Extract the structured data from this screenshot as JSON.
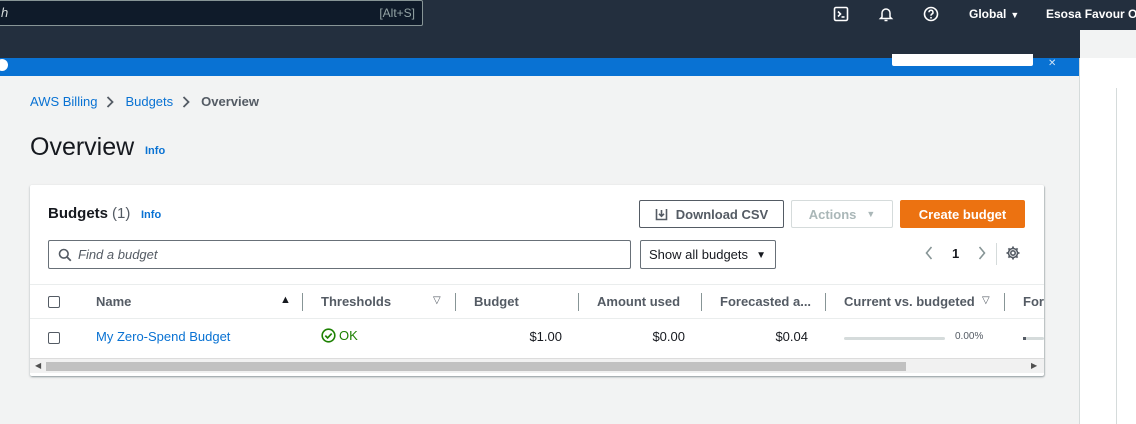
{
  "topnav": {
    "search_stub": "h",
    "search_shortcut": "[Alt+S]",
    "region_label": "Global",
    "account_label": "Esosa Favour O"
  },
  "breadcrumb": {
    "items": [
      "AWS Billing",
      "Budgets"
    ],
    "current": "Overview"
  },
  "page": {
    "title": "Overview",
    "info": "Info"
  },
  "budgets": {
    "title": "Budgets",
    "count": "(1)",
    "info": "Info",
    "download_label": "Download CSV",
    "actions_label": "Actions",
    "create_label": "Create budget",
    "search_placeholder": "Find a budget",
    "filter_value": "Show all budgets",
    "page_number": "1",
    "columns": [
      "Name",
      "Thresholds",
      "Budget",
      "Amount used",
      "Forecasted a...",
      "Current vs. budgeted",
      "For"
    ],
    "rows": [
      {
        "name": "My Zero-Spend Budget",
        "thresholds": "OK",
        "budget": "$1.00",
        "amount_used": "$0.00",
        "forecasted": "$0.04",
        "current_vs_budgeted": "0.00%",
        "current_vs_budgeted_fraction": 0.0
      }
    ]
  },
  "colors": {
    "nav_bg": "#232f3e",
    "link": "#0972d3",
    "primary": "#ec7211",
    "success": "#1d8102"
  }
}
